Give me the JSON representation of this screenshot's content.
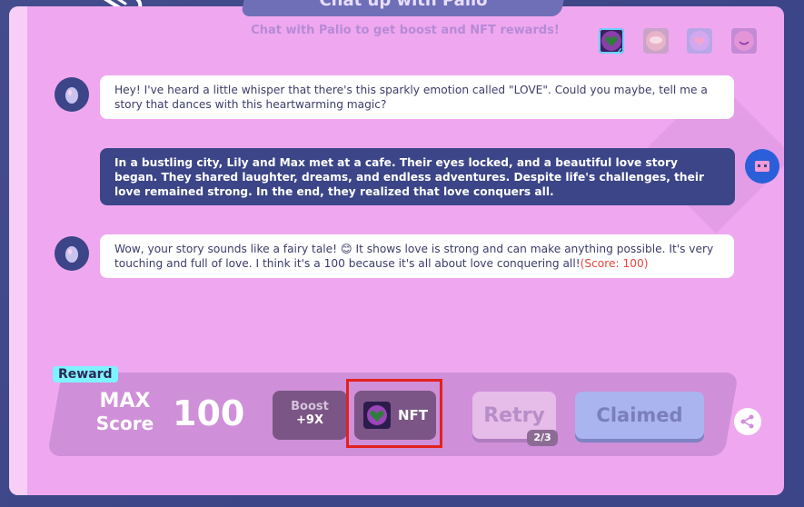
{
  "header": {
    "title": "Chat up with Palio",
    "subtitle": "Chat with Palio to get boost and NFT rewards!"
  },
  "emotions": [
    {
      "icon": "love-emotion-icon",
      "selected": true
    },
    {
      "icon": "cloud-emotion-icon",
      "selected": false
    },
    {
      "icon": "heart-emotion-icon",
      "selected": false
    },
    {
      "icon": "smile-emotion-icon",
      "selected": false
    }
  ],
  "chat": {
    "messages": [
      {
        "role": "bot",
        "text": "Hey! I've heard a little whisper that there's this sparkly emotion called \"LOVE\". Could you maybe, tell me a story that dances with this heartwarming magic?"
      },
      {
        "role": "user",
        "text": "In a bustling city, Lily and Max met at a cafe. Their eyes locked, and a beautiful love story began. They shared laughter, dreams, and endless adventures. Despite life's challenges, their love remained strong. In the end, they realized that love conquers all."
      },
      {
        "role": "bot",
        "text": "Wow, your story sounds like a fairy tale! 😊 It shows love is strong and can make anything possible. It's very touching and full of love. I think it's a 100 because it's all about love conquering all!",
        "score_text": "(Score: 100)"
      }
    ]
  },
  "reward": {
    "tag": "Reward",
    "max_line1": "MAX",
    "max_line2": "Score",
    "score": "100",
    "boost_label": "Boost",
    "boost_value": "+9X",
    "nft_label": "NFT",
    "retry_label": "Retry",
    "retry_count": "2/3",
    "claimed_label": "Claimed"
  },
  "colors": {
    "background": "#3c4587",
    "panel": "#efa8ef",
    "highlight": "#e3211f",
    "score_inline": "#e8453c"
  }
}
